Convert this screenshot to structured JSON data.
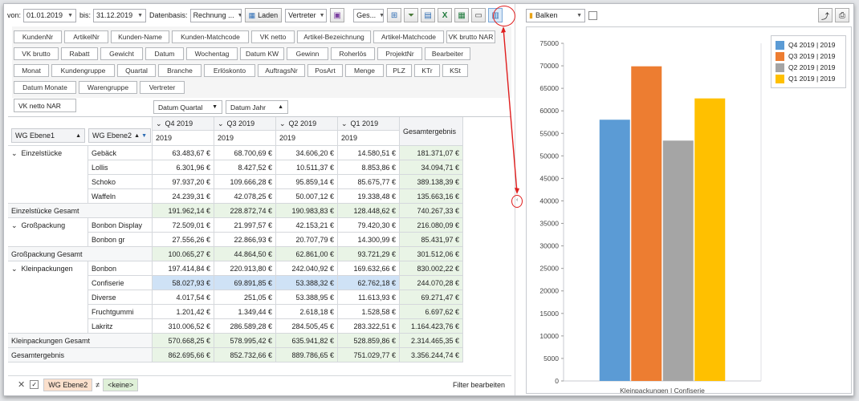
{
  "toolbar": {
    "von_label": "von:",
    "von_value": "01.01.2019",
    "bis_label": "bis:",
    "bis_value": "31.12.2019",
    "datenbasis_label": "Datenbasis:",
    "datenbasis_value": "Rechnung ...",
    "laden_label": "Laden",
    "vertreter_value": "Vertreter",
    "ges_value": "Ges..."
  },
  "field_chips": [
    "KundenNr",
    "ArtikelNr",
    "Kunden-Name",
    "Kunden-Matchcode",
    "VK netto",
    "Artikel-Bezeichnung",
    "Artikel-Matchcode",
    "VK brutto NAR",
    "VK brutto",
    "Rabatt",
    "Gewicht",
    "Datum",
    "Wochentag",
    "Datum KW",
    "Gewinn",
    "Roherlös",
    "ProjektNr",
    "Bearbeiter",
    "Monat",
    "Kundengruppe",
    "Quartal",
    "Branche",
    "Erlöskonto",
    "AuftragsNr",
    "PosArt",
    "Menge",
    "PLZ",
    "KTr",
    "KSt",
    "Datum Monate",
    "Warengruppe",
    "Vertreter"
  ],
  "data_field": "VK netto NAR",
  "column_fields": [
    "Datum Quartal",
    "Datum Jahr"
  ],
  "row_fields": [
    "WG Ebene1",
    "WG Ebene2"
  ],
  "columns": [
    {
      "quarter": "Q4 2019",
      "year": "2019"
    },
    {
      "quarter": "Q3 2019",
      "year": "2019"
    },
    {
      "quarter": "Q2 2019",
      "year": "2019"
    },
    {
      "quarter": "Q1 2019",
      "year": "2019"
    }
  ],
  "grand_total_header": "Gesamtergebnis",
  "rows": [
    {
      "l1": "Einzelstücke",
      "l2": "Gebäck",
      "v": [
        "63.483,67 €",
        "68.700,69 €",
        "34.606,20 €",
        "14.580,51 €",
        "181.371,07 €"
      ]
    },
    {
      "l1": "",
      "l2": "Lollis",
      "v": [
        "6.301,96 €",
        "8.427,52 €",
        "10.511,37 €",
        "8.853,86 €",
        "34.094,71 €"
      ]
    },
    {
      "l1": "",
      "l2": "Schoko",
      "v": [
        "97.937,20 €",
        "109.666,28 €",
        "95.859,14 €",
        "85.675,77 €",
        "389.138,39 €"
      ]
    },
    {
      "l1": "",
      "l2": "Waffeln",
      "v": [
        "24.239,31 €",
        "42.078,25 €",
        "50.007,12 €",
        "19.338,48 €",
        "135.663,16 €"
      ]
    },
    {
      "total": "Einzelstücke Gesamt",
      "v": [
        "191.962,14 €",
        "228.872,74 €",
        "190.983,83 €",
        "128.448,62 €",
        "740.267,33 €"
      ]
    },
    {
      "l1": "Großpackung",
      "l2": "Bonbon Display",
      "v": [
        "72.509,01 €",
        "21.997,57 €",
        "42.153,21 €",
        "79.420,30 €",
        "216.080,09 €"
      ]
    },
    {
      "l1": "",
      "l2": "Bonbon gr",
      "v": [
        "27.556,26 €",
        "22.866,93 €",
        "20.707,79 €",
        "14.300,99 €",
        "85.431,97 €"
      ]
    },
    {
      "total": "Großpackung Gesamt",
      "v": [
        "100.065,27 €",
        "44.864,50 €",
        "62.861,00 €",
        "93.721,29 €",
        "301.512,06 €"
      ]
    },
    {
      "l1": "Kleinpackungen",
      "l2": "Bonbon",
      "v": [
        "197.414,84 €",
        "220.913,80 €",
        "242.040,92 €",
        "169.632,66 €",
        "830.002,22 €"
      ]
    },
    {
      "l1": "",
      "l2": "Confiserie",
      "selected": true,
      "v": [
        "58.027,93 €",
        "69.891,85 €",
        "53.388,32 €",
        "62.762,18 €",
        "244.070,28 €"
      ]
    },
    {
      "l1": "",
      "l2": "Diverse",
      "v": [
        "4.017,54 €",
        "251,05 €",
        "53.388,95 €",
        "11.613,93 €",
        "69.271,47 €"
      ]
    },
    {
      "l1": "",
      "l2": "Fruchtgummi",
      "v": [
        "1.201,42 €",
        "1.349,44 €",
        "2.618,18 €",
        "1.528,58 €",
        "6.697,62 €"
      ]
    },
    {
      "l1": "",
      "l2": "Lakritz",
      "v": [
        "310.006,52 €",
        "286.589,28 €",
        "284.505,45 €",
        "283.322,51 €",
        "1.164.423,76 €"
      ]
    },
    {
      "total": "Kleinpackungen Gesamt",
      "v": [
        "570.668,25 €",
        "578.995,42 €",
        "635.941,82 €",
        "528.859,86 €",
        "2.314.465,35 €"
      ]
    },
    {
      "total": "Gesamtergebnis",
      "v": [
        "862.695,66 €",
        "852.732,66 €",
        "889.786,65 €",
        "751.029,77 €",
        "3.356.244,74 €"
      ]
    }
  ],
  "status": {
    "filter_field": "WG Ebene2",
    "neq": "≠",
    "filter_value": "<keine>",
    "edit_filter": "Filter bearbeiten"
  },
  "chart_toolbar": {
    "chart_type": "Balken"
  },
  "chart_data": {
    "type": "bar",
    "categories": [
      "Kleinpackungen | Confiserie"
    ],
    "series": [
      {
        "name": "Q4 2019 | 2019",
        "values": [
          58027.93
        ],
        "color": "#5b9bd5"
      },
      {
        "name": "Q3 2019 | 2019",
        "values": [
          69891.85
        ],
        "color": "#ed7d31"
      },
      {
        "name": "Q2 2019 | 2019",
        "values": [
          53388.32
        ],
        "color": "#a5a5a5"
      },
      {
        "name": "Q1 2019 | 2019",
        "values": [
          62762.18
        ],
        "color": "#ffc000"
      }
    ],
    "ylim": [
      0,
      75000
    ],
    "yticks": [
      "75000",
      "70000",
      "65000",
      "60000",
      "55000",
      "50000",
      "45000",
      "40000",
      "35000",
      "30000",
      "25000",
      "20000",
      "15000",
      "10000",
      "5000",
      "0"
    ],
    "legend_position": "top-right",
    "grid": false
  }
}
